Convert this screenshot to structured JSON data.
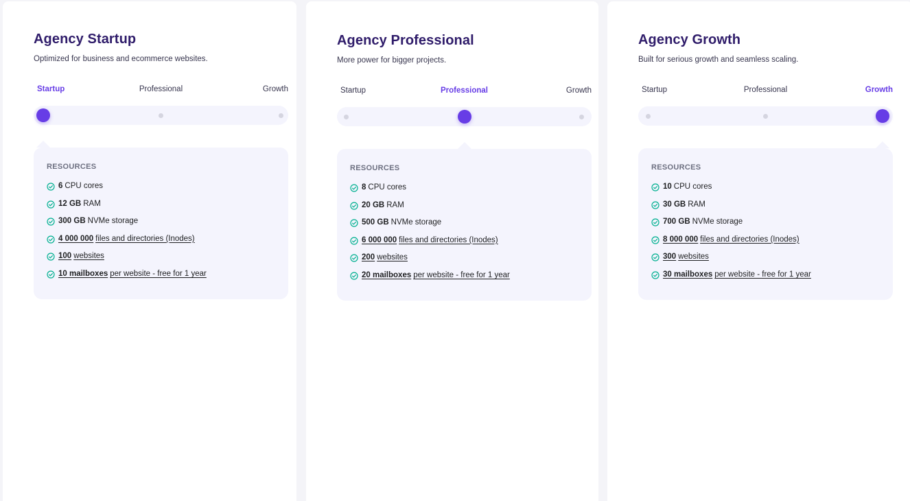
{
  "colors": {
    "accent": "#673de6",
    "title": "#2f1c6a",
    "check": "#00b090",
    "panel": "#f4f4fd",
    "page": "#f4f4f8"
  },
  "plans": [
    {
      "title": "Agency Startup",
      "subtitle": "Optimized for business and ecommerce websites.",
      "tiers": [
        "Startup",
        "Professional",
        "Growth"
      ],
      "selected_tier": "Startup",
      "resources_heading": "RESOURCES",
      "resources": [
        {
          "value": "6",
          "text": "CPU cores"
        },
        {
          "value": "12 GB",
          "text": "RAM"
        },
        {
          "value": "300 GB",
          "text": "NVMe storage"
        },
        {
          "value": "4 000 000",
          "text": "files and directories (Inodes)"
        },
        {
          "value": "100",
          "text": "websites"
        },
        {
          "value": "10 mailboxes",
          "text": "per website - free for 1 year"
        }
      ]
    },
    {
      "title": "Agency Professional",
      "subtitle": "More power for bigger projects.",
      "tiers": [
        "Startup",
        "Professional",
        "Growth"
      ],
      "selected_tier": "Professional",
      "resources_heading": "RESOURCES",
      "resources": [
        {
          "value": "8",
          "text": "CPU cores"
        },
        {
          "value": "20 GB",
          "text": "RAM"
        },
        {
          "value": "500 GB",
          "text": "NVMe storage"
        },
        {
          "value": "6 000 000",
          "text": "files and directories (Inodes)"
        },
        {
          "value": "200",
          "text": "websites"
        },
        {
          "value": "20 mailboxes",
          "text": "per website - free for 1 year"
        }
      ]
    },
    {
      "title": "Agency Growth",
      "subtitle": "Built for serious growth and seamless scaling.",
      "tiers": [
        "Startup",
        "Professional",
        "Growth"
      ],
      "selected_tier": "Growth",
      "resources_heading": "RESOURCES",
      "resources": [
        {
          "value": "10",
          "text": "CPU cores"
        },
        {
          "value": "30 GB",
          "text": "RAM"
        },
        {
          "value": "700 GB",
          "text": "NVMe storage"
        },
        {
          "value": "8 000 000",
          "text": "files and directories (Inodes)"
        },
        {
          "value": "300",
          "text": "websites"
        },
        {
          "value": "30 mailboxes",
          "text": "per website - free for 1 year"
        }
      ]
    }
  ]
}
